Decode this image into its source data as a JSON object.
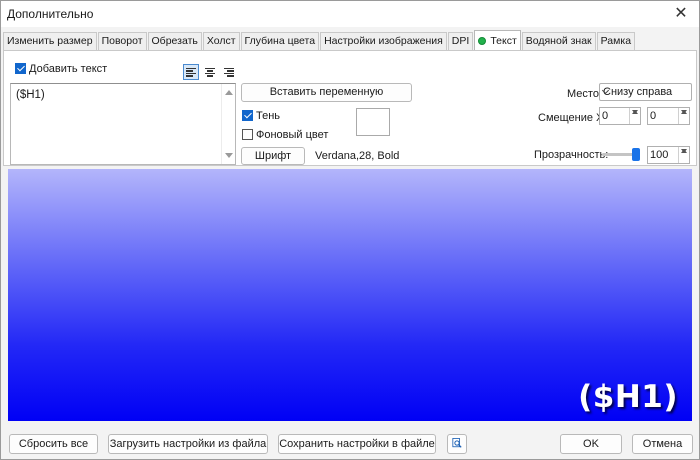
{
  "window": {
    "title": "Дополнительно",
    "close_glyph": "✕"
  },
  "tabs": [
    {
      "label": "Изменить размер"
    },
    {
      "label": "Поворот"
    },
    {
      "label": "Обрезать"
    },
    {
      "label": "Холст"
    },
    {
      "label": "Глубина цвета"
    },
    {
      "label": "Настройки изображения"
    },
    {
      "label": "DPI"
    },
    {
      "label": "Текст",
      "active": true
    },
    {
      "label": "Водяной знак"
    },
    {
      "label": "Рамка"
    }
  ],
  "text_panel": {
    "add_text_label": "Добавить текст",
    "add_text_checked": true,
    "text_value": "($H1)",
    "insert_variable_label": "Вставить переменную",
    "shadow_label": "Тень",
    "shadow_checked": true,
    "background_color_label": "Фоновый цвет",
    "background_color_checked": false,
    "font_button_label": "Шрифт",
    "font_description": "Verdana,28, Bold",
    "place_label": "Место:",
    "place_value": "Снизу справа",
    "offset_label": "Смещение XY:",
    "offset_x": "0",
    "offset_y": "0",
    "opacity_label": "Прозрачность:",
    "opacity_value": "100"
  },
  "preview": {
    "overlay_text": "($H1)"
  },
  "footer": {
    "reset_label": "Сбросить все",
    "load_label": "Загрузить настройки из файла",
    "save_label": "Сохранить настройки в файле",
    "ok_label": "OK",
    "cancel_label": "Отмена"
  },
  "colors": {
    "accent": "#1166cc",
    "active_dot": "#22b14c",
    "preview_top": "#b3b5fb",
    "preview_bottom": "#0000f5"
  }
}
